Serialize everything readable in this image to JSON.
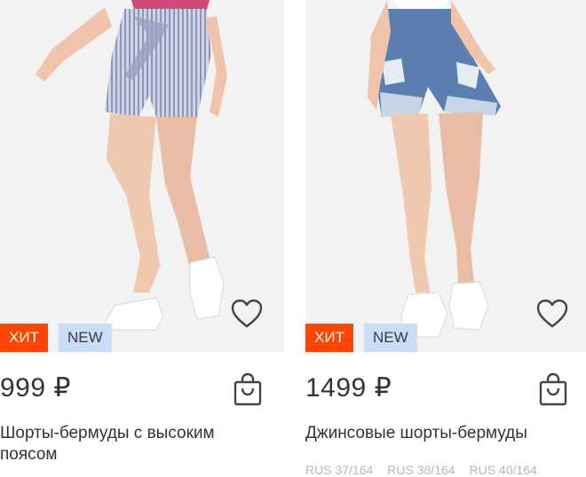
{
  "products": [
    {
      "badges": {
        "hit": "ХИТ",
        "new": "NEW"
      },
      "price": "999 ₽",
      "title": "Шорты-бермуды с высоким поясом",
      "icons": {
        "favorite": "heart-icon",
        "cart": "shopping-bag-icon"
      }
    },
    {
      "badges": {
        "hit": "ХИТ",
        "new": "NEW"
      },
      "price": "1499 ₽",
      "title": "Джинсовые шорты-бермуды",
      "sizes": [
        "RUS 37/164",
        "RUS 38/164",
        "RUS 40/164"
      ],
      "icons": {
        "favorite": "heart-icon",
        "cart": "shopping-bag-icon"
      }
    }
  ],
  "colors": {
    "hit_badge": "#ff4500",
    "new_badge": "#c9ddf6",
    "text": "#333333",
    "muted": "#b8b8b8"
  }
}
